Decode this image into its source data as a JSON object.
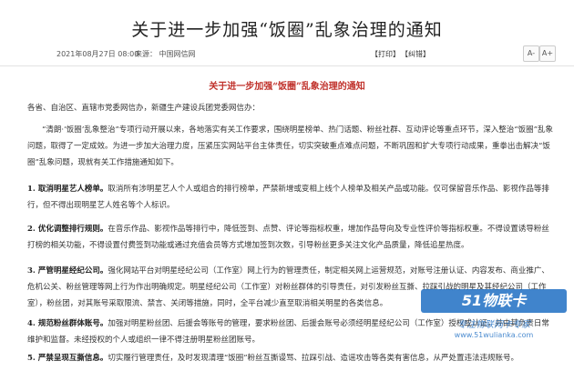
{
  "article": {
    "title": "关于进一步加强“饭圈”乱象治理的通知",
    "date": "2021年08月27日 08:00",
    "source": "来源：  中国网信网",
    "print_label": "【打印】",
    "correct_label": "【纠错】",
    "font_smaller": "A-",
    "font_larger": "A+",
    "subtitle": "关于进一步加强“饭圈”乱象治理的通知",
    "recipients": "各省、自治区、直辖市党委网信办，新疆生产建设兵团党委网信办：",
    "intro": "“清朗·‘饭圈’乱象整治”专项行动开展以来，各地落实有关工作要求，围绕明星榜单、热门话题、粉丝社群、互动评论等重点环节，深入整治“饭圈”乱象问题，取得了一定成效。为进一步加大治理力度，压紧压实网站平台主体责任，切实突破重点难点问题，不断巩固和扩大专项行动成果，重拳出击解决“饭圈”乱象问题，现就有关工作措施通知如下。",
    "items": [
      {
        "heading": "1. 取消明星艺人榜单。",
        "text": "取消所有涉明星艺人个人或组合的排行榜单，严禁新增或变相上线个人榜单及相关产品或功能。仅可保留音乐作品、影视作品等排行，但不得出现明星艺人姓名等个人标识。"
      },
      {
        "heading": "2. 优化调整排行规则。",
        "text": "在音乐作品、影视作品等排行中，降低签到、点赞、评论等指标权重，增加作品导向及专业性评价等指标权重。不得设置诱导粉丝打榜的相关功能，不得设置付费签到功能或通过充值会员等方式增加签到次数，引导粉丝更多关注文化产品质量，降低追星热度。"
      },
      {
        "heading": "3. 严管明星经纪公司。",
        "text": "强化网站平台对明星经纪公司（工作室）网上行为的管理责任，制定相关网上运营规范，对账号注册认证、内容发布、商业推广、危机公关、粉丝管理等网上行为作出明确规定。明星经纪公司（工作室）对粉丝群体的引导责任，对引发粉丝互撕、拉踩引战的明星及其经纪公司（工作室），粉丝团，对其账号采取限流、禁言、关闭等措施，同时，全平台减少直至取消相关明星的各类信息。"
      },
      {
        "heading": "4. 规范粉丝群体账号。",
        "text": "加强对明星粉丝团、后援会等账号的管理，要求粉丝团、后援会账号必须经明星经纪公司（工作室）授权或认证，并由其负责日常维护和监督。未经授权的个人或组织一律不得注册明星粉丝团账号。"
      },
      {
        "heading": "5. 严禁呈现互撕信息。",
        "text": "切实履行管理责任，及时发现清理“饭圈”粉丝互撕谩骂、拉踩引战、造谣攻击等各类有害信息，从严处置违法违规账号。"
      }
    ]
  },
  "watermark": {
    "logo_text": "51物联卡",
    "slogan": "专注物联网卡专家",
    "url": "www.51wulianka.com"
  }
}
